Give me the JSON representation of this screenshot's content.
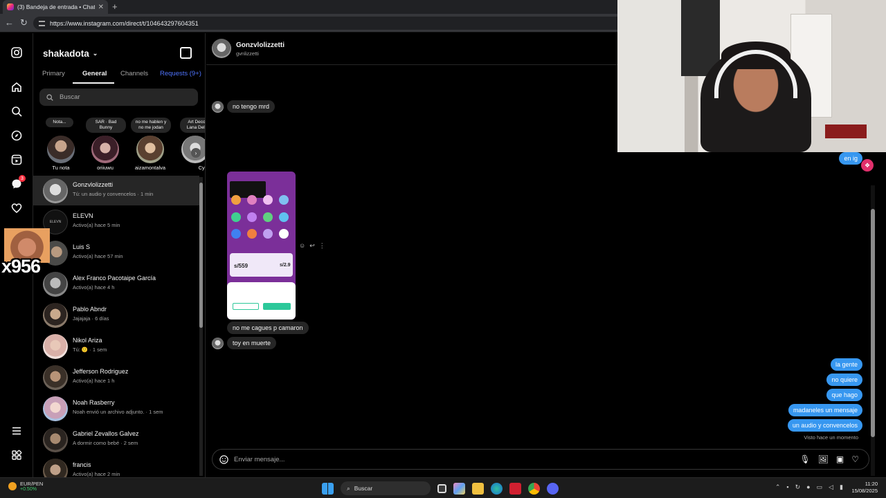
{
  "browser": {
    "tab_title": "(3) Bandeja de entrada • Chats",
    "url": "https://www.instagram.com/direct/t/104643297604351"
  },
  "rail": {
    "messages_badge": "3"
  },
  "inbox": {
    "account": "shakadota",
    "tabs": [
      {
        "label": "Primary"
      },
      {
        "label": "General"
      },
      {
        "label": "Channels"
      },
      {
        "label": "Requests (9+)"
      }
    ],
    "search_placeholder": "Buscar",
    "notes": [
      {
        "bubble": "Nota...",
        "name": "Tu nota"
      },
      {
        "bubble": "SAR · Bad Bunny",
        "name": "oriiuwu"
      },
      {
        "bubble": "no me hablen y no me jodan",
        "name": "aizamontalva"
      },
      {
        "bubble": "Art Deco · Lana Del R",
        "name": "Cyl"
      }
    ],
    "threads": [
      {
        "name": "Gonzvlolizzetti",
        "sub": "Tú: un audio y convencelos · 1 min"
      },
      {
        "name": "ELEVN",
        "sub": "Activo(a) hace 5 min"
      },
      {
        "name": "Luis S",
        "sub": "Activo(a) hace 57 min"
      },
      {
        "name": "Alex Franco Pacotaipe García",
        "sub": "Activo(a) hace 4 h"
      },
      {
        "name": "Pablo Abndr",
        "sub": "Jajajaja · 6 días"
      },
      {
        "name": "Nikol Ariza",
        "sub": "Tú: 🙂 · 1 sem"
      },
      {
        "name": "Jefferson Rodriguez",
        "sub": "Activo(a) hace 1 h"
      },
      {
        "name": "Noah Rasberry",
        "sub": "Noah envió un archivo adjunto. · 1 sem"
      },
      {
        "name": "Gabriel Zevallos Galvez",
        "sub": "A dormir como bebé · 2 sem"
      },
      {
        "name": "francis",
        "sub": "Activo(a) hace 2 min"
      }
    ]
  },
  "chat": {
    "name": "Gonzvlolizzetti",
    "username": "gvnlizzetti",
    "incoming": [
      "no tengo mrd",
      "no me cagues p camaron",
      "toy en muerte"
    ],
    "outgoing_top": "en ig",
    "outgoing": [
      "la gente",
      "no quiere",
      "que hago",
      "madaneles un mensaje",
      "un audio y convencelos"
    ],
    "seen": "Visto hace un momento",
    "composer_placeholder": "Enviar mensaje..."
  },
  "screenshot_preview": {
    "price1": "s/559",
    "price2": "s/2.9"
  },
  "overlay": {
    "stream_label": "x956"
  },
  "taskbar": {
    "ticker_label": "EUR/PEN",
    "ticker_value": "+0.50%",
    "search_label": "Buscar",
    "time": "11:20",
    "date": "15/08/2025"
  },
  "colors": {
    "accent": "#3797f0",
    "link": "#4f74ff",
    "badge": "#ff3040"
  }
}
